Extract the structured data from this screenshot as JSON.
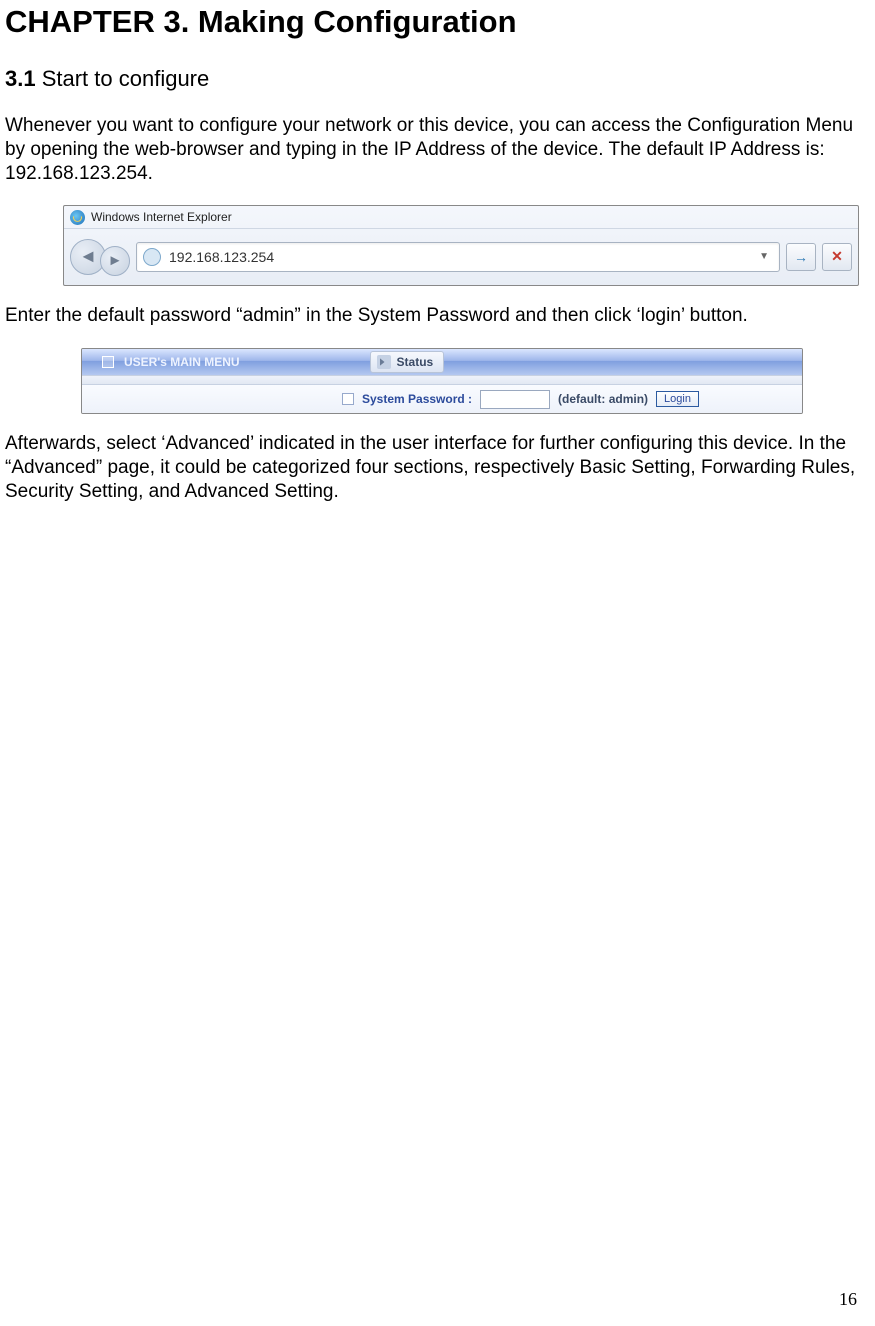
{
  "chapter_title": "CHAPTER 3.    Making Configuration",
  "section": {
    "num": "3.1",
    "title": "  Start to configure"
  },
  "para1": "Whenever you want to configure your network or this device, you can access the Configuration Menu by opening the web-browser and typing in the IP Address of the device. The default IP Address is: 192.168.123.254.",
  "ie": {
    "window_title": "Windows Internet Explorer",
    "url": "192.168.123.254",
    "back_glyph": "◄",
    "fwd_glyph": "►",
    "dropdown_glyph": "▼",
    "go_glyph": "→",
    "stop_glyph": "✕"
  },
  "para2": "Enter the default password “admin” in the System Password and then click ‘login’ button.",
  "login": {
    "menu_title": "USER's MAIN MENU",
    "status_label": "Status",
    "password_label": "System Password :",
    "hint": "(default: admin)",
    "button": "Login"
  },
  "para3": "Afterwards, select ‘Advanced’ indicated in the user interface for further configuring this device. In the “Advanced” page, it could be categorized four sections, respectively Basic Setting, Forwarding Rules, Security Setting, and Advanced Setting.",
  "page_number": "16"
}
